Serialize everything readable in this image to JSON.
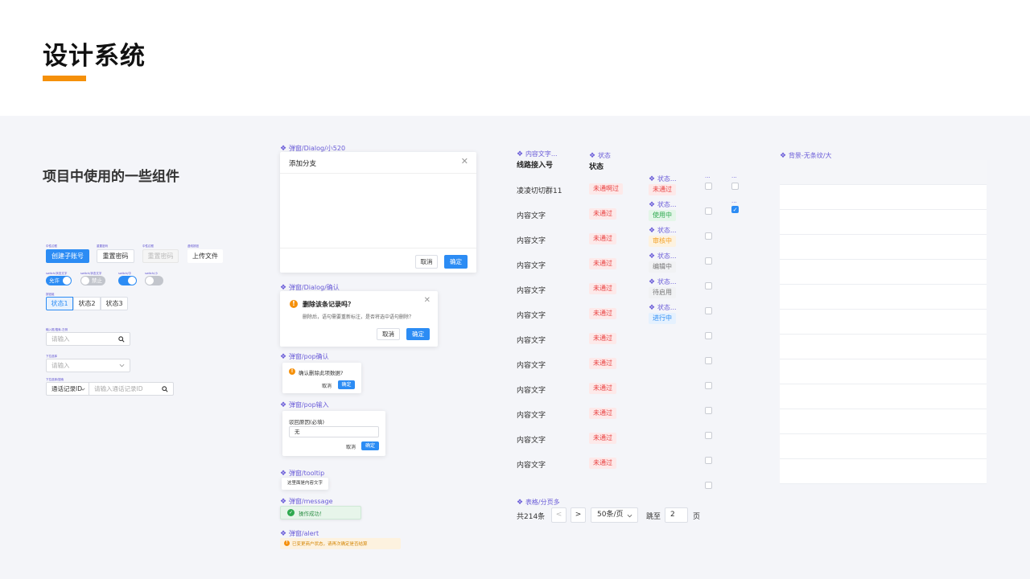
{
  "page": {
    "title": "设计系统",
    "subtitle": "项目中使用的一些组件",
    "accent": "#f5900a",
    "primary": "#2c8cf4"
  },
  "left": {
    "tiny_captions": [
      "中性边框",
      "重置密码",
      "中性边框",
      "虚线按钮",
      "switch/状态文字",
      "switch/状态文字",
      "switch/中",
      "switch/小",
      "按钮组",
      "输入框/搜索-左侧",
      "下拉选择",
      "下拉选择/搜索"
    ],
    "buttons": {
      "create": "创建子账号",
      "reset": "重置密码",
      "reset_disabled": "重置密码",
      "upload": "上传文件"
    },
    "switches": {
      "on_label": "允许",
      "off_label": "禁止"
    },
    "segments": [
      "状态1",
      "状态2",
      "状态3"
    ],
    "search_input": {
      "placeholder": "请输入"
    },
    "select": {
      "placeholder": "请输入"
    },
    "combo": {
      "select_value": "通话记录ID",
      "placeholder": "请输入通话记录ID"
    }
  },
  "middle": {
    "dialog_cap": "弹窗/Dialog/小520",
    "dialog_title": "添加分支",
    "dialog_cancel": "取消",
    "dialog_ok": "确定",
    "confirm_cap": "弹窗/Dialog/确认",
    "confirm_title": "删除该条记录吗？",
    "confirm_desc": "删除后，语句需要重新标注，是否将选中语句删除？",
    "confirm_cancel": "取消",
    "confirm_ok": "确定",
    "pop_cap": "弹窗/pop确认",
    "pop_text": "确认删除此项数据?",
    "pop_cancel": "取消",
    "pop_ok": "确定",
    "popinput_cap": "弹窗/pop输入",
    "popinput_label": "驳回原因(必填)",
    "popinput_value": "无",
    "popinput_cancel": "取消",
    "popinput_ok": "确定",
    "tooltip_cap": "弹窗/tooltip",
    "tooltip_text": "这里面是内容文字",
    "message_cap": "弹窗/message",
    "message_text": "操作成功！",
    "alert_cap": "弹窗/alert",
    "alert_text": "已变更商户状态，请再次确定是否结算"
  },
  "table": {
    "cap_col1": "内容文字...",
    "cap_col2": "状态",
    "header_col1": "线路接入号",
    "header_col2": "状态",
    "rows": [
      {
        "name": "凌凌切切群11",
        "tag": "未通啊过"
      },
      {
        "name": "内容文字",
        "tag": "未通过"
      },
      {
        "name": "内容文字",
        "tag": "未通过"
      },
      {
        "name": "内容文字",
        "tag": "未通过"
      },
      {
        "name": "内容文字",
        "tag": "未通过"
      },
      {
        "name": "内容文字",
        "tag": "未通过"
      },
      {
        "name": "内容文字",
        "tag": "未通过"
      },
      {
        "name": "内容文字",
        "tag": "未通过"
      },
      {
        "name": "内容文字",
        "tag": "未通过"
      },
      {
        "name": "内容文字",
        "tag": "未通过"
      },
      {
        "name": "内容文字",
        "tag": "未通过"
      },
      {
        "name": "内容文字",
        "tag": "未通过"
      }
    ],
    "status_cap": "状态...",
    "status_tags": [
      {
        "label": "未通过",
        "color": "red"
      },
      {
        "label": "使用中",
        "color": "green"
      },
      {
        "label": "审核中",
        "color": "orange"
      },
      {
        "label": "编辑中",
        "color": "gray"
      },
      {
        "label": "待启用",
        "color": "gray"
      },
      {
        "label": "进行中",
        "color": "blue"
      }
    ],
    "cb_cap": "...",
    "pager_cap": "表格/分页多",
    "pager_total": "共214条",
    "pager_prev": "<",
    "pager_next": ">",
    "pager_size": "50条/页",
    "pager_goto": "跳至",
    "pager_page": "2",
    "pager_page_unit": "页"
  },
  "right": {
    "cap": "背景-无条纹/大"
  }
}
